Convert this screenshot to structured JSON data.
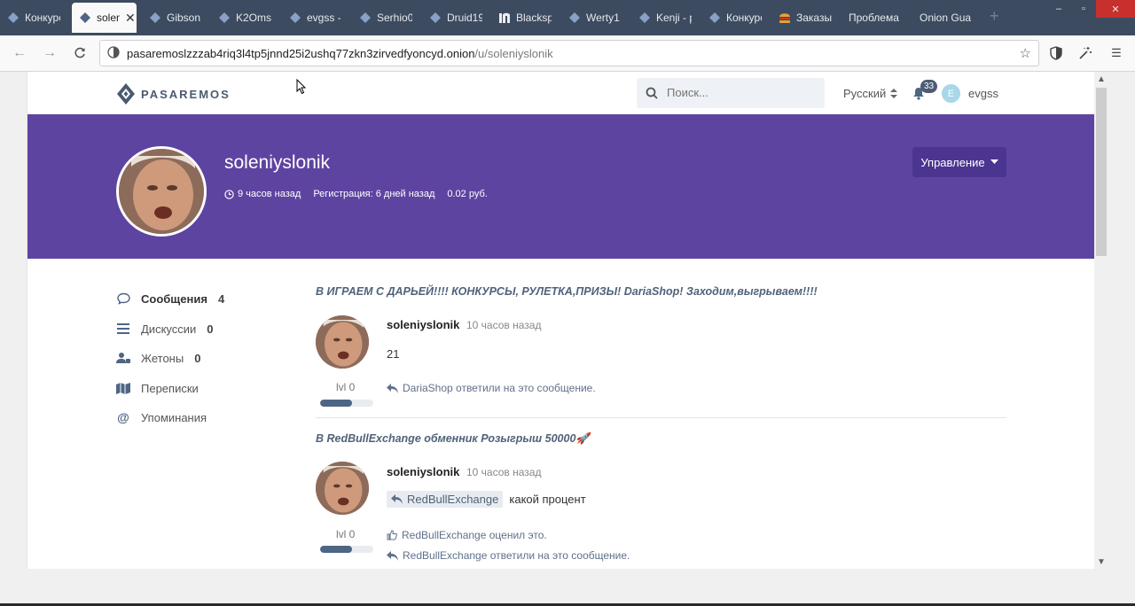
{
  "browser": {
    "tabs": [
      {
        "title": "Конкурс",
        "favicon": "pasaremos-diamond-icon",
        "active": false
      },
      {
        "title": "solen",
        "favicon": "pasaremos-diamond-icon",
        "active": true
      },
      {
        "title": "Gibson",
        "favicon": "pasaremos-diamond-icon",
        "active": false
      },
      {
        "title": "K2Oms",
        "favicon": "pasaremos-diamond-icon",
        "active": false
      },
      {
        "title": "evgss -",
        "favicon": "pasaremos-diamond-icon",
        "active": false
      },
      {
        "title": "Serhio0",
        "favicon": "pasaremos-diamond-icon",
        "active": false
      },
      {
        "title": "Druid19",
        "favicon": "pasaremos-diamond-icon",
        "active": false
      },
      {
        "title": "Blacksp",
        "favicon": "blacksprut-icon",
        "active": false
      },
      {
        "title": "Werty1",
        "favicon": "pasaremos-diamond-icon",
        "active": false
      },
      {
        "title": "Kenji - p",
        "favicon": "pasaremos-diamond-icon",
        "active": false
      },
      {
        "title": "Конкурс",
        "favicon": "pasaremos-diamond-icon",
        "active": false
      },
      {
        "title": "Заказы",
        "favicon": "burger-icon",
        "active": false
      },
      {
        "title": "Проблема",
        "favicon": "",
        "active": false
      },
      {
        "title": "Onion Gua",
        "favicon": "",
        "active": false
      }
    ],
    "url_host": "pasaremoslzzzab4riq3l4tp5jnnd25i2ushq77zkn3zirvedfyoncyd.onion",
    "url_path": "/u/soleniyslonik"
  },
  "site": {
    "logo_text": "PASAREMOS",
    "search_placeholder": "Поиск...",
    "language": "Русский",
    "notifications_count": "33",
    "user_initial": "E",
    "username": "evgss"
  },
  "profile": {
    "name": "soleniyslonik",
    "last_seen": "9 часов назад",
    "registered": "Регистрация: 6 дней назад",
    "balance": "0.02 руб.",
    "manage_label": "Управление"
  },
  "sidebar": {
    "items": [
      {
        "label": "Сообщения",
        "count": "4",
        "icon": "comment-icon"
      },
      {
        "label": "Дискуссии",
        "count": "0",
        "icon": "list-icon"
      },
      {
        "label": "Жетоны",
        "count": "0",
        "icon": "user-badge-icon"
      },
      {
        "label": "Переписки",
        "count": "",
        "icon": "map-icon"
      },
      {
        "label": "Упоминания",
        "count": "",
        "icon": "at-icon"
      }
    ]
  },
  "posts": [
    {
      "topic": "В ИГРАЕМ С ДАРЬЕЙ!!!! КОНКУРСЫ, РУЛЕТКА,ПРИЗЫ! DariaShop! Заходим,выгрываем!!!!",
      "author": "soleniyslonik",
      "time": "10 часов назад",
      "body": "21",
      "reply_to": "",
      "level": "lvl 0",
      "level_progress": 0.6,
      "notes": [
        {
          "icon": "reply-icon",
          "text": "DariaShop ответили на это сообщение."
        }
      ]
    },
    {
      "topic": "В RedBullExchange обменник Розыгрыш 50000🚀",
      "author": "soleniyslonik",
      "time": "10 часов назад",
      "body": "какой процент",
      "reply_to": "RedBullExchange",
      "level": "lvl 0",
      "level_progress": 0.6,
      "notes": [
        {
          "icon": "thumbs-up-icon",
          "text": "RedBullExchange оценил это."
        },
        {
          "icon": "reply-icon",
          "text": "RedBullExchange ответили на это сообщение."
        }
      ]
    }
  ],
  "colors": {
    "banner": "#5e44a1",
    "manage_button": "#4b3590",
    "level_fill": "#4e6584",
    "topic_text": "#50627a"
  }
}
